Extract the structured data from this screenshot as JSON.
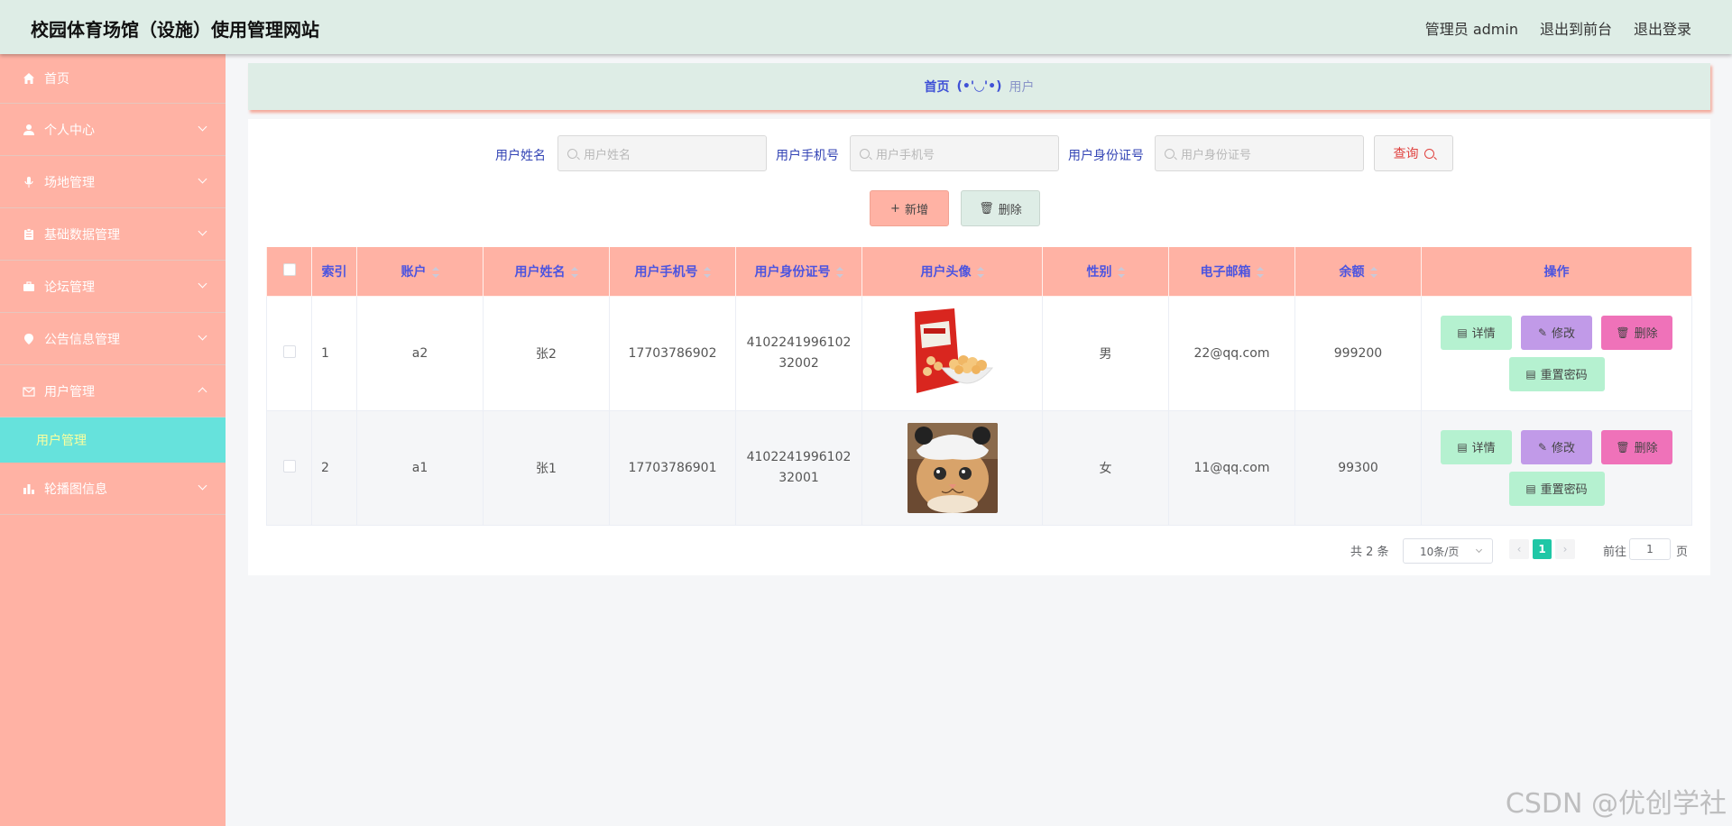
{
  "header": {
    "title": "校园体育场馆（设施）使用管理网站",
    "admin_label": "管理员 admin",
    "to_front": "退出到前台",
    "logout": "退出登录"
  },
  "sidebar": {
    "items": [
      {
        "label": "首页",
        "icon": "home-icon"
      },
      {
        "label": "个人中心",
        "icon": "user-icon"
      },
      {
        "label": "场地管理",
        "icon": "mic-icon"
      },
      {
        "label": "基础数据管理",
        "icon": "clipboard-icon"
      },
      {
        "label": "论坛管理",
        "icon": "briefcase-icon"
      },
      {
        "label": "公告信息管理",
        "icon": "pin-icon"
      },
      {
        "label": "用户管理",
        "icon": "mail-icon"
      },
      {
        "label": "轮播图信息",
        "icon": "bar-chart-icon"
      }
    ],
    "submenu": {
      "label": "用户管理"
    }
  },
  "breadcrumb": {
    "home": "首页",
    "sep": "(•'◡'•)",
    "current": "用户"
  },
  "search": {
    "name_label": "用户姓名",
    "name_placeholder": "用户姓名",
    "phone_label": "用户手机号",
    "phone_placeholder": "用户手机号",
    "id_label": "用户身份证号",
    "id_placeholder": "用户身份证号",
    "query_label": "查询"
  },
  "actions": {
    "add_label": "新增",
    "delete_label": "删除"
  },
  "table": {
    "headers": [
      "索引",
      "账户",
      "用户姓名",
      "用户手机号",
      "用户身份证号",
      "用户头像",
      "性别",
      "电子邮箱",
      "余额",
      "操作"
    ],
    "rows": [
      {
        "index": "1",
        "account": "a2",
        "name": "张2",
        "phone": "17703786902",
        "id_card": "410224199610232002",
        "avatar": "snack-photo",
        "gender": "男",
        "email": "22@qq.com",
        "balance": "999200"
      },
      {
        "index": "2",
        "account": "a1",
        "name": "张1",
        "phone": "17703786901",
        "id_card": "410224199610232001",
        "avatar": "cat-photo",
        "gender": "女",
        "email": "11@qq.com",
        "balance": "99300"
      }
    ],
    "ops": {
      "detail": "详情",
      "edit": "修改",
      "delete": "删除",
      "reset": "重置密码"
    }
  },
  "pagination": {
    "total": "共 2 条",
    "page_size": "10条/页",
    "current": "1",
    "goto": "前往",
    "jump_value": "1",
    "page_suffix": "页"
  },
  "watermark": "CSDN @优创学社"
}
